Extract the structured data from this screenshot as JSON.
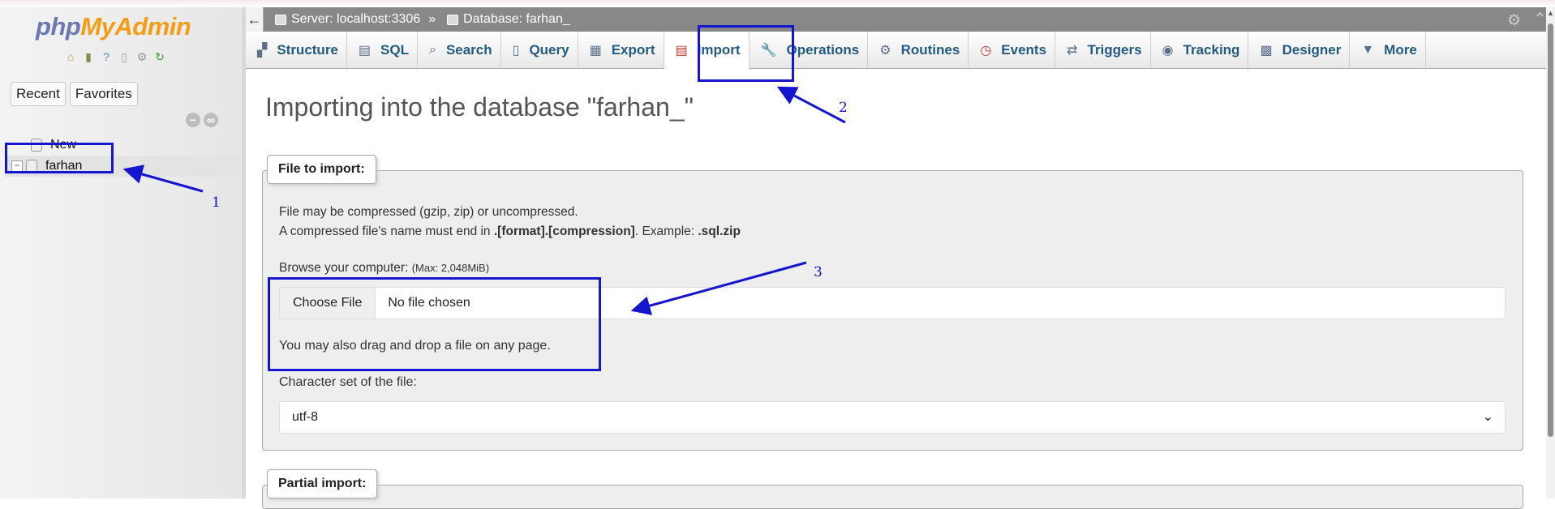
{
  "app": {
    "logo_part1": "php",
    "logo_part2": "MyAdmin"
  },
  "sidebar": {
    "icons": [
      "home-icon",
      "logout-icon",
      "help-icon",
      "docs-icon",
      "settings-icon",
      "reload-icon"
    ],
    "tabs": [
      "Recent",
      "Favorites"
    ],
    "tree": [
      {
        "label": "New"
      },
      {
        "label": "farhan_"
      }
    ]
  },
  "breadcrumb": {
    "server": "Server: localhost:3306",
    "separator": "»",
    "database": "Database: farhan_"
  },
  "tabs": [
    {
      "label": "Structure",
      "icon": "structure-icon"
    },
    {
      "label": "SQL",
      "icon": "sql-icon"
    },
    {
      "label": "Search",
      "icon": "search-icon"
    },
    {
      "label": "Query",
      "icon": "query-icon"
    },
    {
      "label": "Export",
      "icon": "export-icon"
    },
    {
      "label": "Import",
      "icon": "import-icon",
      "active": true
    },
    {
      "label": "Operations",
      "icon": "operations-icon"
    },
    {
      "label": "Routines",
      "icon": "routines-icon"
    },
    {
      "label": "Events",
      "icon": "events-icon"
    },
    {
      "label": "Triggers",
      "icon": "triggers-icon"
    },
    {
      "label": "Tracking",
      "icon": "tracking-icon"
    },
    {
      "label": "Designer",
      "icon": "designer-icon"
    },
    {
      "label": "More",
      "icon": "more-icon"
    }
  ],
  "main": {
    "title": "Importing into the database \"farhan_\"",
    "file_section": {
      "legend": "File to import:",
      "desc_line1": "File may be compressed (gzip, zip) or uncompressed.",
      "desc_line2_a": "A compressed file's name must end in ",
      "desc_line2_b": ".[format].[compression]",
      "desc_line2_c": ". Example: ",
      "desc_line2_d": ".sql.zip",
      "browse_label": "Browse your computer:",
      "browse_max": "(Max: 2,048MiB)",
      "choose_file": "Choose File",
      "no_file": "No file chosen",
      "dragdrop": "You may also drag and drop a file on any page.",
      "charset_label": "Character set of the file:",
      "charset_value": "utf-8"
    },
    "partial_section": {
      "legend": "Partial import:"
    }
  },
  "annotations": {
    "labels": [
      "1",
      "2",
      "3"
    ],
    "color": "#1515d0"
  }
}
